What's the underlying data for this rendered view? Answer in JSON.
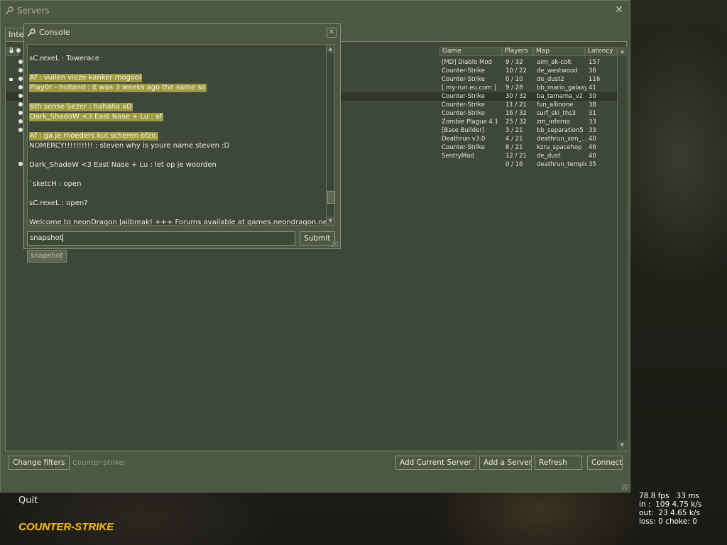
{
  "servers_window": {
    "title": "Servers",
    "close_glyph": "✕",
    "tab_label": "Inter",
    "columns": {
      "game": "Game",
      "players": "Players",
      "map": "Map",
      "latency": "Latency"
    },
    "rows": [
      {
        "game": "[MD] Diablo Mod",
        "players": "9 / 32",
        "map": "aim_ak-colt",
        "latency": "157",
        "icon": "bot"
      },
      {
        "game": "Counter-Strike",
        "players": "10 / 22",
        "map": "de_westwood",
        "latency": "36",
        "icon": "bot"
      },
      {
        "game": "Counter-Strike",
        "players": "0 / 10",
        "map": "de_dust2",
        "latency": "116",
        "icon": "lock-bot"
      },
      {
        "game": "[ my-run.eu.com ]",
        "players": "9 / 28",
        "map": "bb_mario_galaxy",
        "latency": "41",
        "icon": "bot"
      },
      {
        "game": "Counter-Strike",
        "players": "30 / 32",
        "map": "ba_tamama_v2",
        "latency": "30",
        "icon": "bot",
        "selected": true
      },
      {
        "game": "Counter-Strike",
        "players": "11 / 21",
        "map": "fun_allinone",
        "latency": "38",
        "icon": "bot"
      },
      {
        "game": "Counter-Strike",
        "players": "16 / 32",
        "map": "surf_ski_ths3",
        "latency": "31",
        "icon": "bot"
      },
      {
        "game": "Zombie Plague 4.1",
        "players": "25 / 32",
        "map": "zm_inferno",
        "latency": "33",
        "icon": "bot"
      },
      {
        "game": "[Base Builder]",
        "players": "3 / 21",
        "map": "bb_separation5",
        "latency": "33",
        "icon": "bot"
      },
      {
        "game": "Deathrun v3.0",
        "players": "4 / 21",
        "map": "deathrun_xen_...",
        "latency": "40",
        "icon": ""
      },
      {
        "game": "Counter-Strike",
        "players": "8 / 21",
        "map": "kzru_spacehop",
        "latency": "46",
        "icon": ""
      },
      {
        "game": "SentryMod",
        "players": "12 / 21",
        "map": "de_dust",
        "latency": "40",
        "icon": ""
      },
      {
        "game": "",
        "players": "0 / 16",
        "map": "deathrun_temple",
        "latency": "35",
        "icon": "bot"
      }
    ],
    "buttons": {
      "change_filters": "Change filters",
      "add_current_server": "Add Current Server",
      "add_a_server": "Add a Server",
      "refresh": "Refresh",
      "connect": "Connect"
    },
    "filter_text": "Counter-Strike;"
  },
  "console": {
    "title": "Console",
    "close_glyph": "✕",
    "log": [
      {
        "text": "sC.rexeL :  Towerace",
        "hl": false
      },
      {
        "text": "Af :  vuilen vieze kanker mogool",
        "hl": true
      },
      {
        "text": "Play0r - holland :  it was 3 weeks ago the same so",
        "hl": true
      },
      {
        "text": "6th sense Sezer :  hahaha xD",
        "hl": true
      },
      {
        "text": "Dark_ShadoW <3 East   Nase + Lu :  af",
        "hl": true
      },
      {
        "text": "Af :  ga je moeders kut scheren ofzo.",
        "hl": true
      },
      {
        "text": "NOMERCY!!!!!!!!!! :  steven why is youre name steven :D",
        "hl": false
      },
      {
        "text": "Dark_ShadoW <3 East   Nase + Lu :  let op je woorden",
        "hl": false
      },
      {
        "text": " `sketcH :  open",
        "hl": false
      },
      {
        "text": "sC.rexeL :  open?",
        "hl": false
      },
      {
        "text": "Welcome to neonDragon Jailbreak! +++ Forums available at games.neondragon.net +++",
        "hl": false
      }
    ],
    "input_value": "snapshot",
    "submit_label": "Submit",
    "autocomplete": "snapshot"
  },
  "hud": {
    "quit_label": "Quit",
    "logo_text": "COUNTER-STRIKE",
    "netgraph": [
      "78.8 fps   33 ms",
      "in :  109 4.75 k/s",
      "out:  23 4.65 k/s",
      "loss: 0 choke: 0"
    ]
  },
  "colors": {
    "panel": "#4c5844",
    "panel_dark": "#3e4838",
    "highlight": "#9d9a43",
    "logo": "#e8b632"
  }
}
